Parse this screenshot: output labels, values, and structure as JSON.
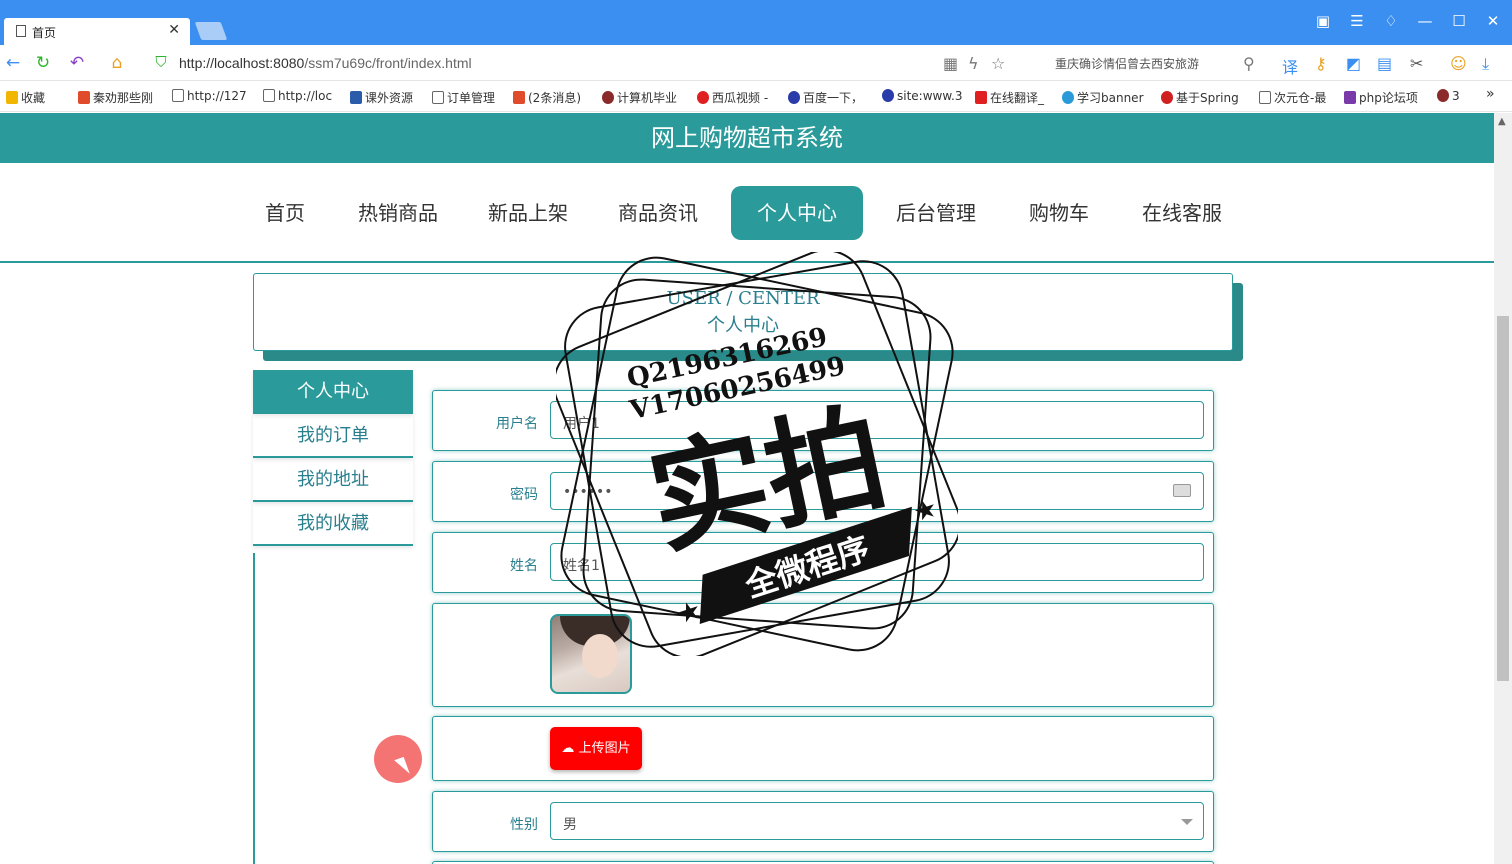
{
  "browser": {
    "tab_title": "首页",
    "url_host": "http://localhost:8080",
    "url_path": "/ssm7u69c/front/index.html",
    "search_text": "重庆确诊情侣曾去西安旅游",
    "bookmarks": [
      "收藏",
      "秦劝那些刚",
      "http://127",
      "http://loc",
      "课外资源",
      "订单管理",
      "(2条消息)",
      "计算机毕业",
      "西瓜视频 -",
      "百度一下，",
      "site:www.3",
      "在线翻译_",
      "学习banner",
      "基于Spring",
      "次元仓-最",
      "php论坛项",
      "3"
    ]
  },
  "site": {
    "title": "网上购物超市系统",
    "nav": [
      "首页",
      "热销商品",
      "新品上架",
      "商品资讯",
      "个人中心",
      "后台管理",
      "购物车",
      "在线客服"
    ],
    "active_nav": "个人中心"
  },
  "user_center": {
    "heading_en": "USER / CENTER",
    "heading_cn": "个人中心",
    "sidebar": [
      "个人中心",
      "我的订单",
      "我的地址",
      "我的收藏"
    ],
    "form": {
      "username_label": "用户名",
      "username_value": "用户1",
      "password_label": "密码",
      "password_value": "••••••",
      "name_label": "姓名",
      "name_value": "姓名1",
      "upload_label": "上传图片",
      "gender_label": "性别",
      "gender_value": "男"
    }
  },
  "watermark": {
    "line1": "Q2196316269",
    "line2": "V17060256499",
    "main": "实拍",
    "banner": "全微程序"
  },
  "colors": {
    "theme": "#2a9a9a",
    "browser_bar": "#3b8ff0",
    "upload": "#ff0000"
  }
}
